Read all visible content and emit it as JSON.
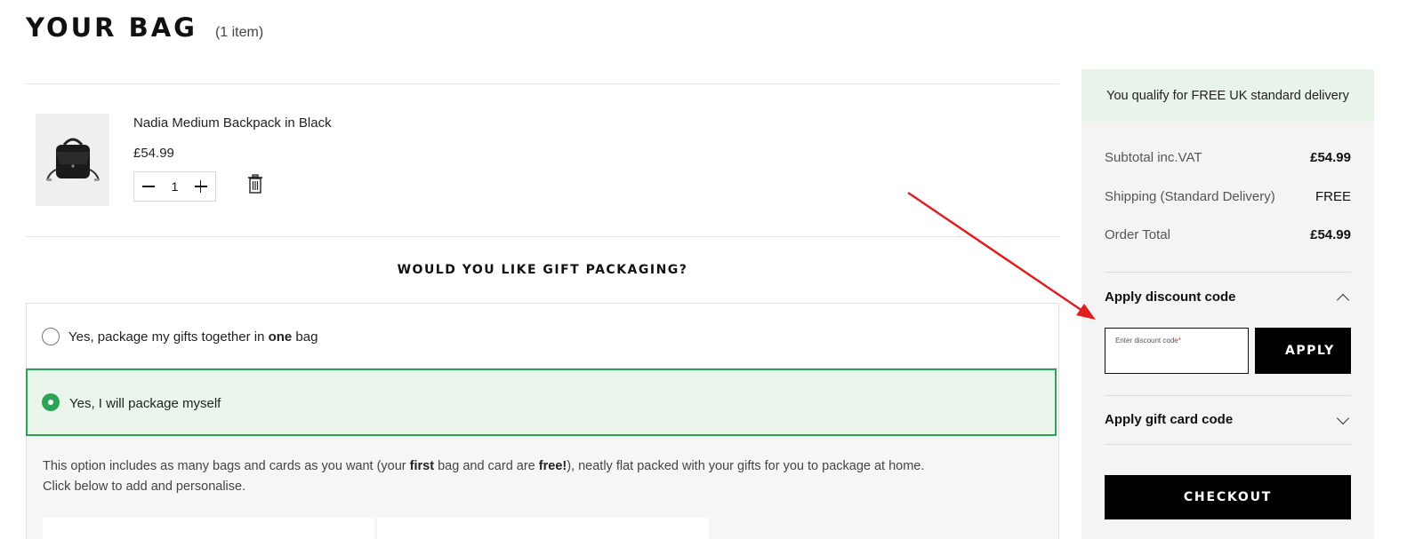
{
  "header": {
    "title": "YOUR BAG",
    "item_count": "(1 item)"
  },
  "bag": {
    "items": [
      {
        "name": "Nadia Medium Backpack in Black",
        "price": "£54.99",
        "quantity": "1",
        "image_icon": "backpack-image"
      }
    ]
  },
  "gift_packaging": {
    "title": "WOULD YOU LIKE GIFT PACKAGING?",
    "option_one_before": "Yes, package my gifts together in ",
    "option_one_bold": "one",
    "option_one_after": " bag",
    "option_two": "Yes, I will package myself",
    "selected_option": 2,
    "description_part1": "This option includes as many bags and cards as you want (your ",
    "description_bold1": "first",
    "description_part2": " bag and card are ",
    "description_bold2": "free!",
    "description_part3": "), neatly flat packed with your gifts for you to package at home.",
    "description_line2": "Click below to add and personalise."
  },
  "summary": {
    "delivery_banner": "You qualify for FREE UK standard delivery",
    "subtotal_label": "Subtotal inc.VAT",
    "subtotal_value": "£54.99",
    "shipping_label": "Shipping (Standard Delivery)",
    "shipping_value": "FREE",
    "total_label": "Order Total",
    "total_value": "£54.99",
    "discount_heading": "Apply discount code",
    "discount_placeholder": "Enter discount code",
    "discount_required_mark": "*",
    "discount_value": "",
    "apply_label": "APPLY",
    "giftcard_heading": "Apply gift card code",
    "checkout_label": "CHECKOUT"
  },
  "colors": {
    "accent_green": "#2aa556",
    "selected_bg": "#eaf5ec",
    "banner_bg": "#e8f3ea",
    "annotation_arrow": "#e02020"
  }
}
